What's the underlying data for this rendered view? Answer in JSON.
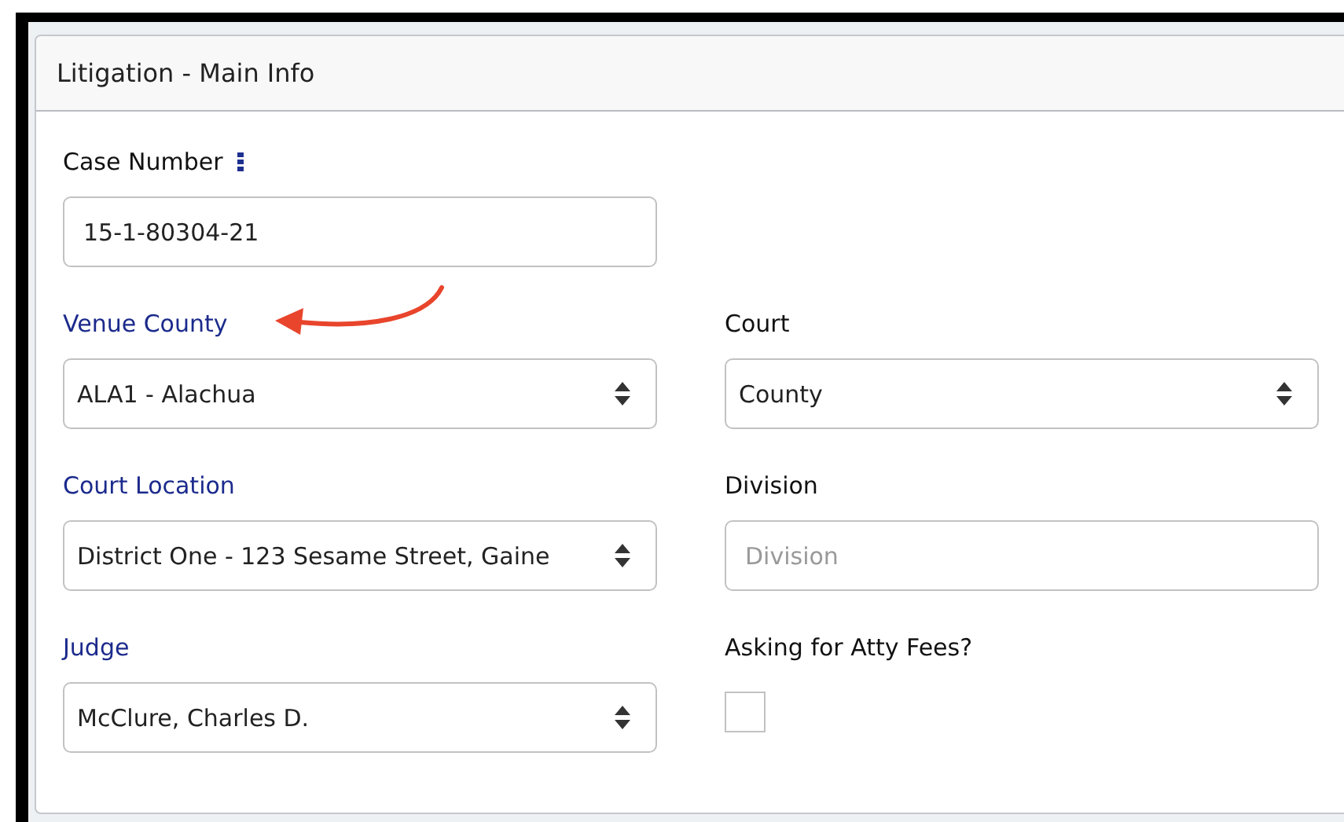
{
  "panel": {
    "title": "Litigation - Main Info"
  },
  "rows": [
    [
      {
        "label": "Case Number",
        "linked": false,
        "info": true,
        "kind": "text",
        "value": "15-1-80304-21"
      }
    ],
    [
      {
        "label": "Venue County",
        "linked": true,
        "info": false,
        "kind": "select",
        "value": "ALA1 - Alachua"
      },
      {
        "label": "Court",
        "linked": false,
        "info": false,
        "kind": "select",
        "value": "County"
      }
    ],
    [
      {
        "label": "Court Location",
        "linked": true,
        "info": false,
        "kind": "select",
        "value": "District One - 123 Sesame Street, Gaine"
      },
      {
        "label": "Division",
        "linked": false,
        "info": false,
        "kind": "text",
        "placeholder": "Division"
      }
    ],
    [
      {
        "label": "Judge",
        "linked": true,
        "info": false,
        "kind": "select",
        "value": "McClure, Charles D."
      },
      {
        "label": "Asking for Atty Fees?",
        "linked": false,
        "info": false,
        "kind": "checkbox",
        "checked": false
      }
    ]
  ]
}
